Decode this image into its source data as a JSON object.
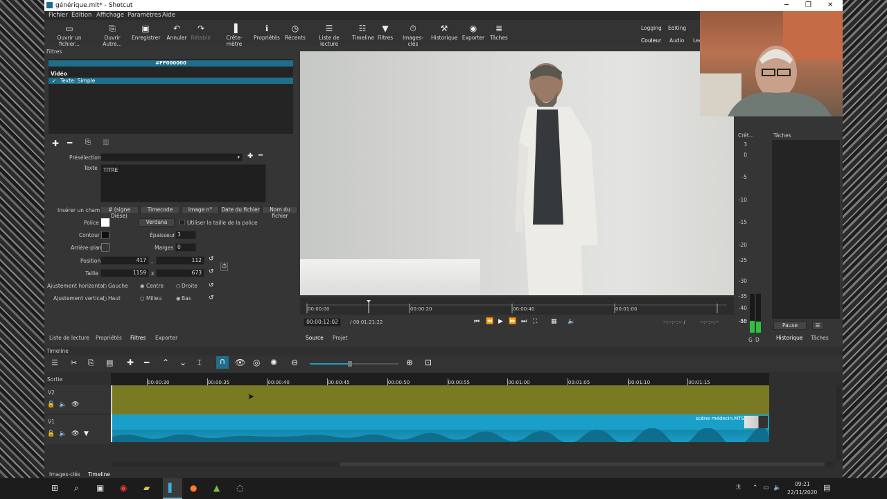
{
  "window": {
    "title": "générique.mlt* - Shotcut",
    "minimize": "─",
    "maximize": "❐",
    "close": "✕"
  },
  "menu": [
    "Fichier",
    "Édition",
    "Affichage",
    "Paramètres",
    "Aide"
  ],
  "toolbar": [
    {
      "label": "Ouvrir un fichier...",
      "icon": "▭"
    },
    {
      "label": "Ouvrir Autre...",
      "icon": "⎘"
    },
    {
      "label": "Enregistrer",
      "icon": "▣"
    },
    {
      "label": "Annuler",
      "icon": "↶"
    },
    {
      "label": "Rétablir",
      "icon": "↷"
    },
    {
      "label": "Crête-mètre",
      "icon": "▐"
    },
    {
      "label": "Propriétés",
      "icon": "ℹ"
    },
    {
      "label": "Récents",
      "icon": "◷"
    },
    {
      "label": "Liste de lecture",
      "icon": "☰"
    },
    {
      "label": "Timeline",
      "icon": "☷"
    },
    {
      "label": "Filtres",
      "icon": "▼"
    },
    {
      "label": "Images-clés",
      "icon": "⏱"
    },
    {
      "label": "Historique",
      "icon": "⚒"
    },
    {
      "label": "Exporter",
      "icon": "◉"
    },
    {
      "label": "Tâches",
      "icon": "≣"
    }
  ],
  "layouts": {
    "row1": [
      "Logging",
      "Editing"
    ],
    "row2": [
      "Couleur",
      "Audio",
      "Lec"
    ]
  },
  "filters": {
    "header": "Filtres",
    "color_bar": "#FF000000",
    "section": "Vidéo",
    "item": "Texte: Simple",
    "check": "✓",
    "preset_label": "Présélection",
    "text_label": "Texte",
    "text_value": "TITRE",
    "insert_label": "Insérer un champ",
    "insert_buttons": [
      "# (signe Dièse)",
      "Timecode",
      "Image n°",
      "Date du fichier",
      "Nom du fichier"
    ],
    "font_label": "Police",
    "font_name": "Verdana",
    "font_size_chk": "Utiliser la taille de la police",
    "outline_label": "Contour",
    "thickness_label": "Épaisseur",
    "thickness_value": "3",
    "bg_label": "Arrière-plan",
    "margins_label": "Marges",
    "margins_value": "0",
    "position_label": "Position",
    "pos_x": "417",
    "pos_sep": ",",
    "pos_y": "112",
    "size_label": "Taille",
    "size_w": "1159",
    "size_sep": "x",
    "size_h": "673",
    "halign_label": "Ajustement horizontal",
    "halign": [
      "Gauche",
      "Centre",
      "Droite"
    ],
    "valign_label": "Ajustement vertical",
    "valign": [
      "Haut",
      "Milieu",
      "Bas"
    ]
  },
  "left_tabs": [
    "Liste de lecture",
    "Propriétés",
    "Filtres",
    "Exporter"
  ],
  "player": {
    "ruler": [
      "00:00:00",
      "00:00:20",
      "00:00:40",
      "00:01:00"
    ],
    "position": "00:00:12:02",
    "duration": "/ 00:01:21:22",
    "in_out": "--:--:--:-- /",
    "out": "--:--:--:--",
    "tabs": [
      "Source",
      "Projet"
    ]
  },
  "meter": {
    "title": "Crêt...",
    "scale": [
      "3",
      "0",
      "-5",
      "-10",
      "-15",
      "-20",
      "-25",
      "-30",
      "-35",
      "-40",
      "-45",
      "-50"
    ],
    "channels": [
      "G",
      "D"
    ],
    "level_L": 0.3,
    "level_R": 0.28
  },
  "jobs": {
    "title": "Tâches",
    "pause": "Pause",
    "menu": "☰",
    "tabs": [
      "Historique",
      "Tâches"
    ]
  },
  "timeline": {
    "header": "Timeline",
    "output": "Sortie",
    "ruler": [
      "00:00:30",
      "00:00:35",
      "00:00:40",
      "00:00:45",
      "00:00:50",
      "00:00:55",
      "00:01:00",
      "00:01:05",
      "00:01:10",
      "00:01:15"
    ],
    "tracks": [
      {
        "name": "V2"
      },
      {
        "name": "V1",
        "clip": "scène médecin.MTS"
      }
    ],
    "zoom_level": 0.45
  },
  "bottom_tabs": [
    "Images-clés",
    "Timeline"
  ],
  "taskbar": {
    "time": "09:21",
    "date": "22/11/2020"
  },
  "colors": {
    "accent": "#1f6f8b",
    "clip_v2": "#7a7a22",
    "clip_v1": "#1aa0c8",
    "meter_green": "#2fbf3f"
  }
}
